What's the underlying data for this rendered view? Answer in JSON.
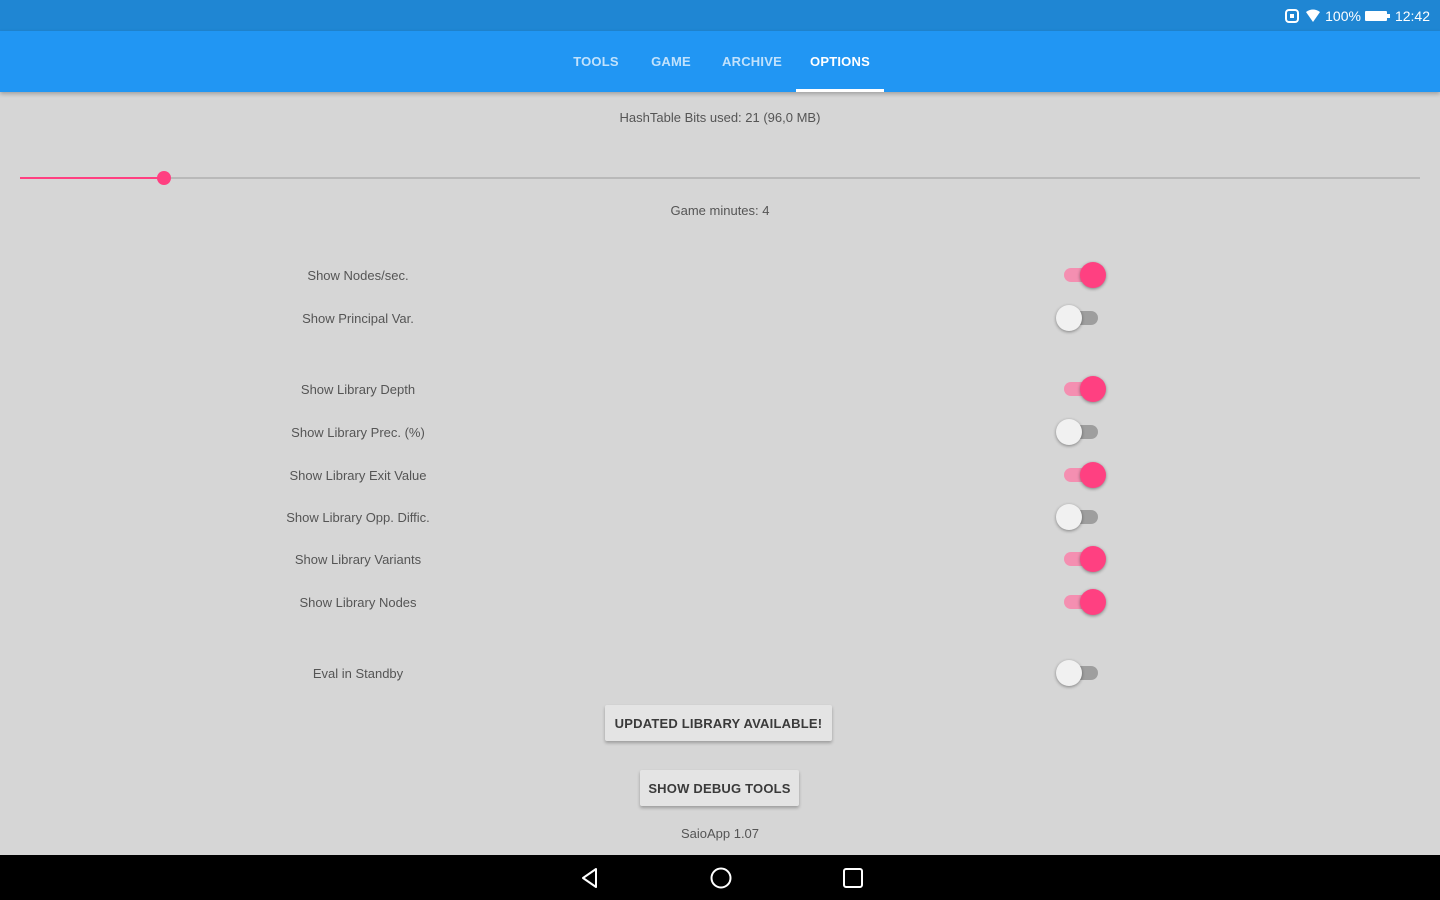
{
  "status_bar": {
    "battery_text": "100%",
    "time": "12:42",
    "icons": [
      "rotation-lock-icon",
      "wifi-icon",
      "battery-icon"
    ]
  },
  "tabs": [
    {
      "label": "TOOLS",
      "active": false
    },
    {
      "label": "GAME",
      "active": false
    },
    {
      "label": "ARCHIVE",
      "active": false
    },
    {
      "label": "OPTIONS",
      "active": true
    }
  ],
  "options": {
    "hashtable_text": "HashTable Bits used: 21 (96,0 MB)",
    "slider_value": 0.103,
    "game_minutes_text": "Game minutes: 4",
    "toggles": [
      {
        "label": "Show Nodes/sec.",
        "on": true
      },
      {
        "label": "Show Principal Var.",
        "on": false
      },
      {
        "label": "Show Library Depth",
        "on": true
      },
      {
        "label": "Show Library Prec. (%)",
        "on": false
      },
      {
        "label": "Show Library Exit Value",
        "on": true
      },
      {
        "label": "Show Library Opp. Diffic.",
        "on": false
      },
      {
        "label": "Show Library Variants",
        "on": true
      },
      {
        "label": "Show Library Nodes",
        "on": true
      },
      {
        "label": "Eval in Standby",
        "on": false
      }
    ],
    "update_button": "UPDATED LIBRARY AVAILABLE!",
    "debug_button": "SHOW DEBUG TOOLS",
    "version_text": "SaioApp 1.07"
  },
  "colors": {
    "app_bar": "#2196f3",
    "status_bar": "#1f86d3",
    "accent": "#ff4081",
    "background": "#d6d6d6"
  },
  "nav_icons": [
    "back-icon",
    "home-icon",
    "recents-icon"
  ]
}
